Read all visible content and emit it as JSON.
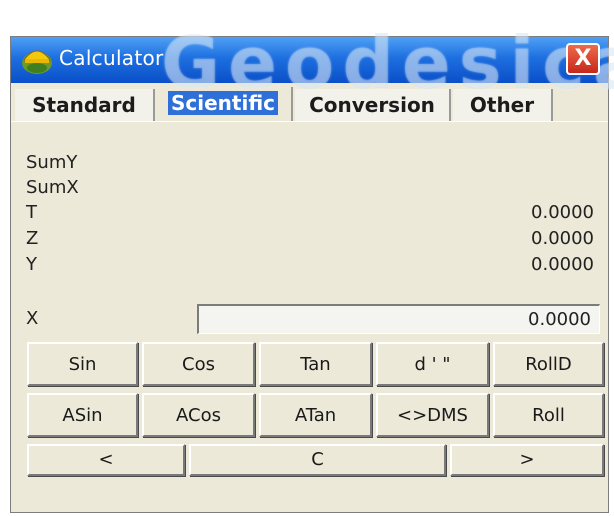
{
  "caption": {
    "text": "[fragmentary caption text at top, partially cropped]"
  },
  "titlebar": {
    "title": "Calculator",
    "watermark": "Geodesical",
    "close_label": "X"
  },
  "tabs": [
    {
      "label": "Standard",
      "active": false
    },
    {
      "label": "Scientific",
      "active": true
    },
    {
      "label": "Conversion",
      "active": false
    },
    {
      "label": "Other",
      "active": false
    }
  ],
  "display": {
    "sumy_label": "SumY",
    "sumx_label": "SumX",
    "t": {
      "label": "T",
      "value": "0.0000"
    },
    "z": {
      "label": "Z",
      "value": "0.0000"
    },
    "y": {
      "label": "Y",
      "value": "0.0000"
    },
    "x": {
      "label": "X",
      "value": "0.0000"
    }
  },
  "buttons": {
    "row1": [
      "Sin",
      "Cos",
      "Tan",
      "d ' \"",
      "RollD"
    ],
    "row2": [
      "ASin",
      "ACos",
      "ATan",
      "<>DMS",
      "Roll"
    ],
    "row3": [
      "<",
      "C",
      ">"
    ]
  },
  "colors": {
    "titlebar": "#1e6fe0",
    "active_tab": "#2f6fd8",
    "close": "#c5281b",
    "body": "#ece9d8"
  }
}
